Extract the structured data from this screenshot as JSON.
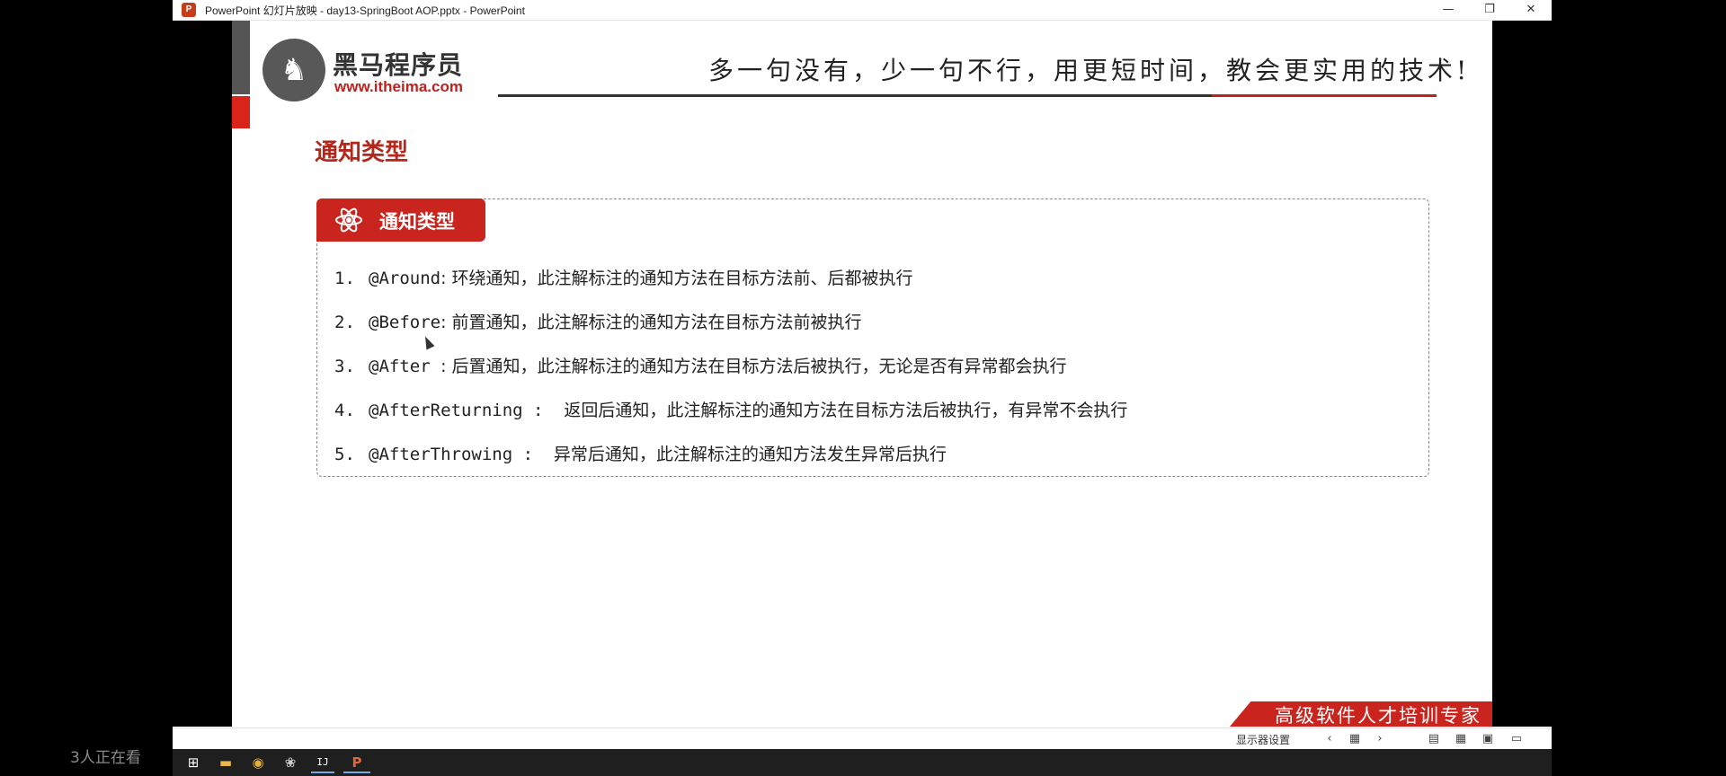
{
  "window": {
    "app_icon_letter": "P",
    "title": "PowerPoint 幻灯片放映  -  day13-SpringBoot AOP.pptx - PowerPoint",
    "minimize": "—",
    "restore": "❐",
    "close": "✕"
  },
  "slide": {
    "logo_glyph": "♞",
    "logo_cn": "黑马程序员",
    "logo_url": "www.itheima.com",
    "slogan": "多一句没有，少一句不行，用更短时间，教会更实用的技术!",
    "heading": "通知类型",
    "box_title": "通知类型",
    "items": [
      {
        "num": "1.",
        "code": "@Around",
        "desc": ": 环绕通知，此注解标注的通知方法在目标方法前、后都被执行"
      },
      {
        "num": "2.",
        "code": "@Before",
        "desc": ": 前置通知，此注解标注的通知方法在目标方法前被执行"
      },
      {
        "num": "3.",
        "code": "@After ",
        "desc": ": 后置通知，此注解标注的通知方法在目标方法后被执行，无论是否有异常都会执行"
      },
      {
        "num": "4.",
        "code": "@AfterReturning :  ",
        "desc": "返回后通知，此注解标注的通知方法在目标方法后被执行，有异常不会执行"
      },
      {
        "num": "5.",
        "code": "@AfterThrowing :  ",
        "desc": "异常后通知，此注解标注的通知方法发生异常后执行"
      }
    ],
    "footer": "高级软件人才培训专家"
  },
  "statusbar": {
    "display_settings": "显示器设置",
    "prev": "‹",
    "grid": "▦",
    "next": "›",
    "normal_view": "▤",
    "sorter_view": "▦",
    "reading_view": "▣",
    "slideshow_view": "▭"
  },
  "taskbar": {
    "start": "⊞",
    "explorer": "▬",
    "chrome": "◉",
    "app3": "❀",
    "intellij": "IJ",
    "powerpoint": "P"
  },
  "overlay": {
    "watching": "3人正在看"
  },
  "colors": {
    "accent_red": "#c9251e",
    "heading_red": "#b2281d"
  }
}
